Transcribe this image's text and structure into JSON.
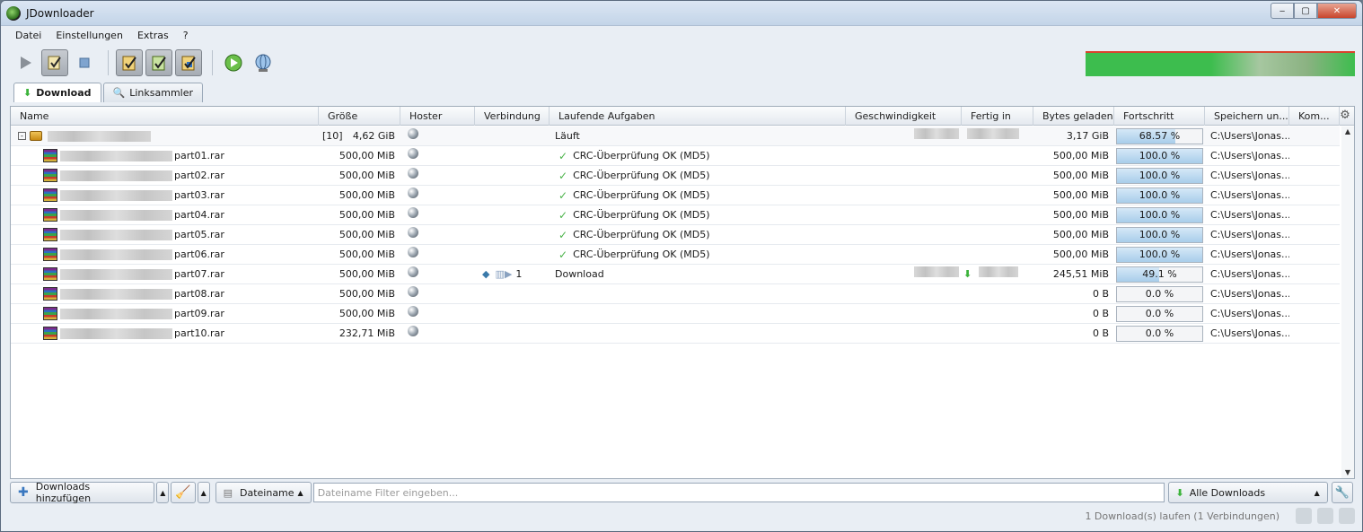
{
  "window": {
    "title": "JDownloader",
    "controls": {
      "minimize": "‒",
      "maximize": "▢",
      "close": "✕"
    }
  },
  "menu": [
    "Datei",
    "Einstellungen",
    "Extras",
    "?"
  ],
  "tabs": [
    {
      "label": "Download"
    },
    {
      "label": "Linksammler"
    }
  ],
  "columns": [
    "Name",
    "Größe",
    "Hoster",
    "Verbindung",
    "Laufende Aufgaben",
    "Geschwindigkeit",
    "Fertig in",
    "Bytes geladen",
    "Fortschritt",
    "Speichern un...",
    "Kom..."
  ],
  "package": {
    "expander": "[-]",
    "count": "[10]",
    "size": "4,62 GiB",
    "task": "Läuft",
    "bytes": "3,17 GiB",
    "progress": "68.57 %",
    "progress_value": 68.57,
    "save": "C:\\Users\\Jonas..."
  },
  "files": [
    {
      "name": "part01.rar",
      "size": "500,00 MiB",
      "task": "CRC-Überprüfung OK (MD5)",
      "bytes": "500,00 MiB",
      "progress": "100.0 %",
      "progress_value": 100,
      "save": "C:\\Users\\Jonas..."
    },
    {
      "name": "part02.rar",
      "size": "500,00 MiB",
      "task": "CRC-Überprüfung OK (MD5)",
      "bytes": "500,00 MiB",
      "progress": "100.0 %",
      "progress_value": 100,
      "save": "C:\\Users\\Jonas..."
    },
    {
      "name": "part03.rar",
      "size": "500,00 MiB",
      "task": "CRC-Überprüfung OK (MD5)",
      "bytes": "500,00 MiB",
      "progress": "100.0 %",
      "progress_value": 100,
      "save": "C:\\Users\\Jonas..."
    },
    {
      "name": "part04.rar",
      "size": "500,00 MiB",
      "task": "CRC-Überprüfung OK (MD5)",
      "bytes": "500,00 MiB",
      "progress": "100.0 %",
      "progress_value": 100,
      "save": "C:\\Users\\Jonas..."
    },
    {
      "name": "part05.rar",
      "size": "500,00 MiB",
      "task": "CRC-Überprüfung OK (MD5)",
      "bytes": "500,00 MiB",
      "progress": "100.0 %",
      "progress_value": 100,
      "save": "C:\\Users\\Jonas..."
    },
    {
      "name": "part06.rar",
      "size": "500,00 MiB",
      "task": "CRC-Überprüfung OK (MD5)",
      "bytes": "500,00 MiB",
      "progress": "100.0 %",
      "progress_value": 100,
      "save": "C:\\Users\\Jonas..."
    },
    {
      "name": "part07.rar",
      "size": "500,00 MiB",
      "conn": "1",
      "task": "Download",
      "bytes": "245,51 MiB",
      "progress": "49.1 %",
      "progress_value": 49.1,
      "save": "C:\\Users\\Jonas..."
    },
    {
      "name": "part08.rar",
      "size": "500,00 MiB",
      "task": "",
      "bytes": "0 B",
      "progress": "0.0 %",
      "progress_value": 0,
      "save": "C:\\Users\\Jonas..."
    },
    {
      "name": "part09.rar",
      "size": "500,00 MiB",
      "task": "",
      "bytes": "0 B",
      "progress": "0.0 %",
      "progress_value": 0,
      "save": "C:\\Users\\Jonas..."
    },
    {
      "name": "part10.rar",
      "size": "232,71 MiB",
      "task": "",
      "bytes": "0 B",
      "progress": "0.0 %",
      "progress_value": 0,
      "save": "C:\\Users\\Jonas..."
    }
  ],
  "bottom": {
    "add_downloads": "Downloads hinzufügen",
    "filter_type": "Dateiname",
    "filter_placeholder": "Dateiname Filter eingeben...",
    "view": "Alle Downloads"
  },
  "status": {
    "text": "1 Download(s) laufen (1 Verbindungen)"
  },
  "colors": {
    "progress_fill": "#a8cdea",
    "speedmeter": "#3dbd4e",
    "check": "#4bb34a"
  }
}
